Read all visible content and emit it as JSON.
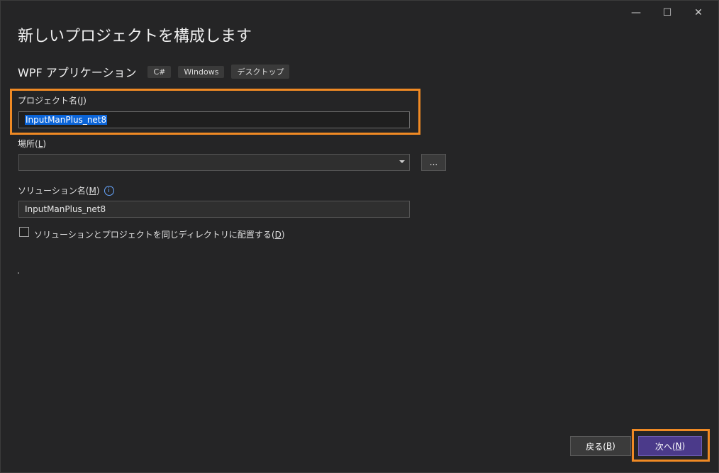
{
  "window": {
    "controls": {
      "minimize": "—",
      "maximize": "☐",
      "close": "✕"
    }
  },
  "page": {
    "title": "新しいプロジェクトを構成します",
    "template_name": "WPF アプリケーション",
    "tags": [
      "C#",
      "Windows",
      "デスクトップ"
    ]
  },
  "form": {
    "project_name": {
      "label": "プロジェクト名(",
      "mnemonic": "J",
      "label_suffix": ")",
      "value": "InputManPlus_net8"
    },
    "location": {
      "label": "場所(",
      "mnemonic": "L",
      "label_suffix": ")",
      "value": "",
      "browse_label": "..."
    },
    "solution_name": {
      "label": "ソリューション名(",
      "mnemonic": "M",
      "label_suffix": ")",
      "value": "InputManPlus_net8",
      "info_icon": "i"
    },
    "same_dir_checkbox": {
      "label": "ソリューションとプロジェクトを同じディレクトリに配置する(",
      "mnemonic": "D",
      "label_suffix": ")",
      "checked": false
    }
  },
  "footer": {
    "back": {
      "label": "戻る(",
      "mnemonic": "B",
      "suffix": ")"
    },
    "next": {
      "label": "次へ(",
      "mnemonic": "N",
      "suffix": ")"
    }
  },
  "colors": {
    "highlight": "#f08a24",
    "next_button": "#4b3a8a",
    "selection": "#0a64d8"
  }
}
